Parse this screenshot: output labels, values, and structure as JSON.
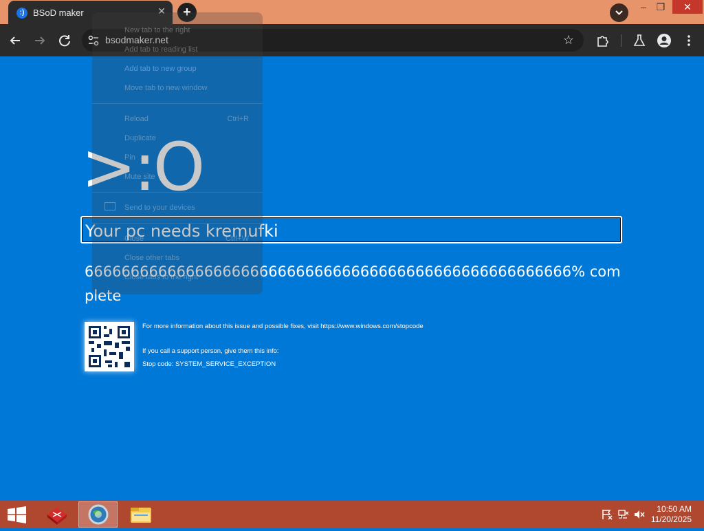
{
  "browser": {
    "tab_title": "BSoD maker",
    "tab_close": "✕",
    "new_tab": "+",
    "url": "bsodmaker.net",
    "window_controls": {
      "minimize": "–",
      "restore": "❐",
      "close": "✕"
    }
  },
  "context_menu": {
    "items": [
      {
        "label": "New tab to the right",
        "shortcut": ""
      },
      {
        "label": "Add tab to reading list",
        "shortcut": ""
      },
      {
        "label": "Add tab to new group",
        "shortcut": ""
      },
      {
        "label": "Move tab to new window",
        "shortcut": ""
      },
      {
        "label": "Reload",
        "shortcut": "Ctrl+R"
      },
      {
        "label": "Duplicate",
        "shortcut": ""
      },
      {
        "label": "Pin",
        "shortcut": ""
      },
      {
        "label": "Mute site",
        "shortcut": ""
      },
      {
        "label": "Send to your devices",
        "shortcut": ""
      },
      {
        "label": "Close",
        "shortcut": "Ctrl+W"
      },
      {
        "label": "Close other tabs",
        "shortcut": ""
      },
      {
        "label": "Close tabs to the right",
        "shortcut": ""
      }
    ]
  },
  "bsod": {
    "sad_face": ">:O",
    "title": "Your pc needs kremufki",
    "progress_text": "66666666666666666666666666666666666666666666666666666% complete",
    "info_line": "For more information about this issue and possible fixes, visit https://www.windows.com/stopcode",
    "support_line": "If you call a support person, give them this info:",
    "stop_code": "Stop code: SYSTEM_SERVICE_EXCEPTION",
    "background_color": "#0078d7"
  },
  "taskbar": {
    "time": "10:50 AM",
    "date": "11/20/2025",
    "color": "#b0472f"
  }
}
